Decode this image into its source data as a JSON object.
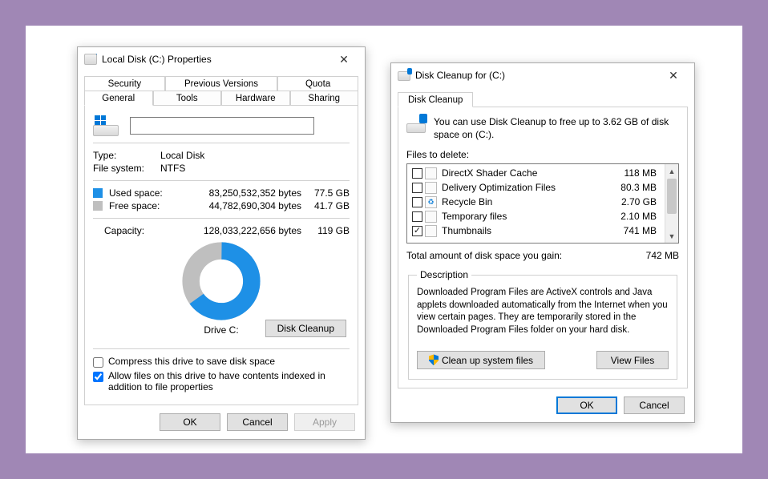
{
  "properties": {
    "title": "Local Disk (C:) Properties",
    "tabs_row1": [
      "Security",
      "Previous Versions",
      "Quota"
    ],
    "tabs_row2": [
      "General",
      "Tools",
      "Hardware",
      "Sharing"
    ],
    "active_tab": "General",
    "name_value": "",
    "type_label": "Type:",
    "type_value": "Local Disk",
    "fs_label": "File system:",
    "fs_value": "NTFS",
    "used_label": "Used space:",
    "used_bytes": "83,250,532,352 bytes",
    "used_gb": "77.5 GB",
    "used_color": "#1e90e6",
    "free_label": "Free space:",
    "free_bytes": "44,782,690,304 bytes",
    "free_gb": "41.7 GB",
    "free_color": "#bfbfbf",
    "capacity_label": "Capacity:",
    "capacity_bytes": "128,033,222,656 bytes",
    "capacity_gb": "119 GB",
    "drive_label": "Drive C:",
    "disk_cleanup_btn": "Disk Cleanup",
    "compress_label": "Compress this drive to save disk space",
    "compress_checked": false,
    "index_label": "Allow files on this drive to have contents indexed in addition to file properties",
    "index_checked": true,
    "ok": "OK",
    "cancel": "Cancel",
    "apply": "Apply"
  },
  "cleanup": {
    "title": "Disk Cleanup for  (C:)",
    "tab": "Disk Cleanup",
    "info": "You can use Disk Cleanup to free up to 3.62 GB of disk space on  (C:).",
    "files_label": "Files to delete:",
    "items": [
      {
        "name": "DirectX Shader Cache",
        "size": "118 MB",
        "checked": false,
        "icon": ""
      },
      {
        "name": "Delivery Optimization Files",
        "size": "80.3 MB",
        "checked": false,
        "icon": ""
      },
      {
        "name": "Recycle Bin",
        "size": "2.70 GB",
        "checked": false,
        "icon": "♻"
      },
      {
        "name": "Temporary files",
        "size": "2.10 MB",
        "checked": false,
        "icon": ""
      },
      {
        "name": "Thumbnails",
        "size": "741 MB",
        "checked": true,
        "icon": ""
      }
    ],
    "gain_label": "Total amount of disk space you gain:",
    "gain_value": "742 MB",
    "desc_legend": "Description",
    "desc_text": "Downloaded Program Files are ActiveX controls and Java applets downloaded automatically from the Internet when you view certain pages. They are temporarily stored in the Downloaded Program Files folder on your hard disk.",
    "cleanup_system": "Clean up system files",
    "view_files": "View Files",
    "ok": "OK",
    "cancel": "Cancel"
  },
  "chart_data": {
    "type": "pie",
    "title": "Drive C:",
    "series": [
      {
        "name": "Used space",
        "value": 77.5,
        "unit": "GB",
        "color": "#1e90e6"
      },
      {
        "name": "Free space",
        "value": 41.7,
        "unit": "GB",
        "color": "#bfbfbf"
      }
    ],
    "total": {
      "label": "Capacity",
      "value": 119,
      "unit": "GB"
    },
    "donut": true
  }
}
